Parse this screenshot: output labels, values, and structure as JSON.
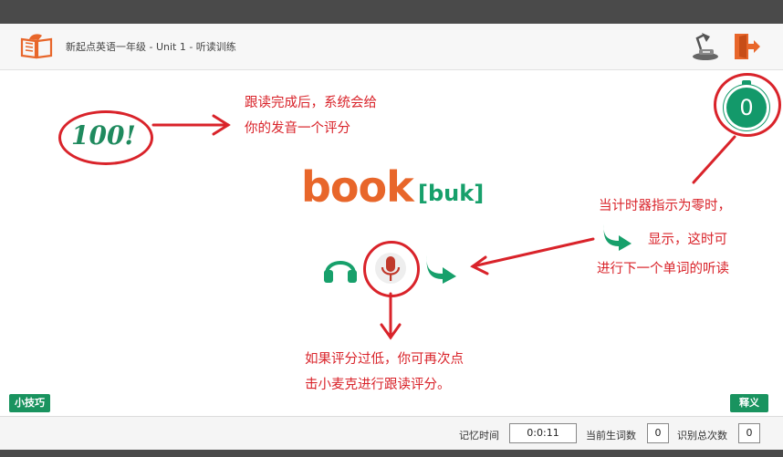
{
  "header": {
    "title": "新起点英语一年级 - Unit 1 - 听读训练"
  },
  "word": {
    "text": "book",
    "phonetic": "[buk]"
  },
  "score": {
    "text": "100!"
  },
  "timer": {
    "value": "0"
  },
  "annotations": {
    "score_note_line1": "跟读完成后，系统会给",
    "score_note_line2": "你的发音一个评分",
    "timer_note_line1": "当计时器指示为零时，",
    "timer_note_line2": "显示，这时可",
    "timer_note_line3": "进行下一个单词的听读",
    "mic_note_line1": "如果评分过低，你可再次点",
    "mic_note_line2": "击小麦克进行跟读评分。"
  },
  "buttons": {
    "tips": "小技巧",
    "definition": "释义"
  },
  "footer": {
    "memory_time_label": "记忆时间",
    "memory_time_value": "0:0:11",
    "current_new_words_label": "当前生词数",
    "current_new_words_value": "0",
    "total_recognitions_label": "识别总次数",
    "total_recognitions_value": "0"
  },
  "icons": {
    "logo": "open-book-icon",
    "settings": "desk-lamp-icon",
    "exit": "exit-door-icon",
    "listen": "headphones-icon",
    "record": "microphone-icon",
    "next": "forward-arrow-icon"
  },
  "colors": {
    "accent_orange": "#e8662a",
    "accent_green": "#17a06b",
    "annotation_red": "#d9232a"
  }
}
